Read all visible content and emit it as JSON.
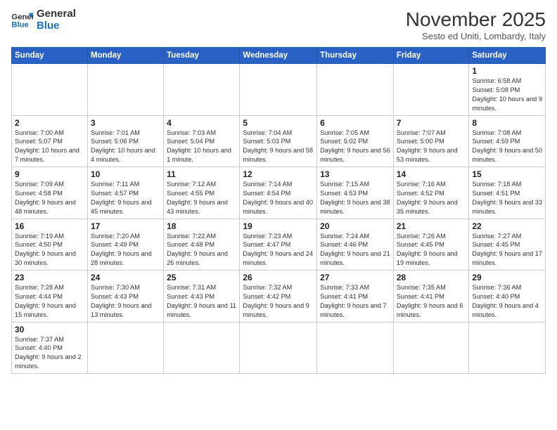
{
  "logo": {
    "line1": "General",
    "line2": "Blue"
  },
  "title": "November 2025",
  "subtitle": "Sesto ed Uniti, Lombardy, Italy",
  "days_header": [
    "Sunday",
    "Monday",
    "Tuesday",
    "Wednesday",
    "Thursday",
    "Friday",
    "Saturday"
  ],
  "weeks": [
    [
      {
        "num": "",
        "info": ""
      },
      {
        "num": "",
        "info": ""
      },
      {
        "num": "",
        "info": ""
      },
      {
        "num": "",
        "info": ""
      },
      {
        "num": "",
        "info": ""
      },
      {
        "num": "",
        "info": ""
      },
      {
        "num": "1",
        "info": "Sunrise: 6:58 AM\nSunset: 5:08 PM\nDaylight: 10 hours\nand 9 minutes."
      }
    ],
    [
      {
        "num": "2",
        "info": "Sunrise: 7:00 AM\nSunset: 5:07 PM\nDaylight: 10 hours\nand 7 minutes."
      },
      {
        "num": "3",
        "info": "Sunrise: 7:01 AM\nSunset: 5:06 PM\nDaylight: 10 hours\nand 4 minutes."
      },
      {
        "num": "4",
        "info": "Sunrise: 7:03 AM\nSunset: 5:04 PM\nDaylight: 10 hours\nand 1 minute."
      },
      {
        "num": "5",
        "info": "Sunrise: 7:04 AM\nSunset: 5:03 PM\nDaylight: 9 hours\nand 58 minutes."
      },
      {
        "num": "6",
        "info": "Sunrise: 7:05 AM\nSunset: 5:02 PM\nDaylight: 9 hours\nand 56 minutes."
      },
      {
        "num": "7",
        "info": "Sunrise: 7:07 AM\nSunset: 5:00 PM\nDaylight: 9 hours\nand 53 minutes."
      },
      {
        "num": "8",
        "info": "Sunrise: 7:08 AM\nSunset: 4:59 PM\nDaylight: 9 hours\nand 50 minutes."
      }
    ],
    [
      {
        "num": "9",
        "info": "Sunrise: 7:09 AM\nSunset: 4:58 PM\nDaylight: 9 hours\nand 48 minutes."
      },
      {
        "num": "10",
        "info": "Sunrise: 7:11 AM\nSunset: 4:57 PM\nDaylight: 9 hours\nand 45 minutes."
      },
      {
        "num": "11",
        "info": "Sunrise: 7:12 AM\nSunset: 4:55 PM\nDaylight: 9 hours\nand 43 minutes."
      },
      {
        "num": "12",
        "info": "Sunrise: 7:14 AM\nSunset: 4:54 PM\nDaylight: 9 hours\nand 40 minutes."
      },
      {
        "num": "13",
        "info": "Sunrise: 7:15 AM\nSunset: 4:53 PM\nDaylight: 9 hours\nand 38 minutes."
      },
      {
        "num": "14",
        "info": "Sunrise: 7:16 AM\nSunset: 4:52 PM\nDaylight: 9 hours\nand 35 minutes."
      },
      {
        "num": "15",
        "info": "Sunrise: 7:18 AM\nSunset: 4:51 PM\nDaylight: 9 hours\nand 33 minutes."
      }
    ],
    [
      {
        "num": "16",
        "info": "Sunrise: 7:19 AM\nSunset: 4:50 PM\nDaylight: 9 hours\nand 30 minutes."
      },
      {
        "num": "17",
        "info": "Sunrise: 7:20 AM\nSunset: 4:49 PM\nDaylight: 9 hours\nand 28 minutes."
      },
      {
        "num": "18",
        "info": "Sunrise: 7:22 AM\nSunset: 4:48 PM\nDaylight: 9 hours\nand 26 minutes."
      },
      {
        "num": "19",
        "info": "Sunrise: 7:23 AM\nSunset: 4:47 PM\nDaylight: 9 hours\nand 24 minutes."
      },
      {
        "num": "20",
        "info": "Sunrise: 7:24 AM\nSunset: 4:46 PM\nDaylight: 9 hours\nand 21 minutes."
      },
      {
        "num": "21",
        "info": "Sunrise: 7:26 AM\nSunset: 4:45 PM\nDaylight: 9 hours\nand 19 minutes."
      },
      {
        "num": "22",
        "info": "Sunrise: 7:27 AM\nSunset: 4:45 PM\nDaylight: 9 hours\nand 17 minutes."
      }
    ],
    [
      {
        "num": "23",
        "info": "Sunrise: 7:28 AM\nSunset: 4:44 PM\nDaylight: 9 hours\nand 15 minutes."
      },
      {
        "num": "24",
        "info": "Sunrise: 7:30 AM\nSunset: 4:43 PM\nDaylight: 9 hours\nand 13 minutes."
      },
      {
        "num": "25",
        "info": "Sunrise: 7:31 AM\nSunset: 4:43 PM\nDaylight: 9 hours\nand 11 minutes."
      },
      {
        "num": "26",
        "info": "Sunrise: 7:32 AM\nSunset: 4:42 PM\nDaylight: 9 hours\nand 9 minutes."
      },
      {
        "num": "27",
        "info": "Sunrise: 7:33 AM\nSunset: 4:41 PM\nDaylight: 9 hours\nand 7 minutes."
      },
      {
        "num": "28",
        "info": "Sunrise: 7:35 AM\nSunset: 4:41 PM\nDaylight: 9 hours\nand 6 minutes."
      },
      {
        "num": "29",
        "info": "Sunrise: 7:36 AM\nSunset: 4:40 PM\nDaylight: 9 hours\nand 4 minutes."
      }
    ],
    [
      {
        "num": "30",
        "info": "Sunrise: 7:37 AM\nSunset: 4:40 PM\nDaylight: 9 hours\nand 2 minutes."
      },
      {
        "num": "",
        "info": ""
      },
      {
        "num": "",
        "info": ""
      },
      {
        "num": "",
        "info": ""
      },
      {
        "num": "",
        "info": ""
      },
      {
        "num": "",
        "info": ""
      },
      {
        "num": "",
        "info": ""
      }
    ]
  ]
}
